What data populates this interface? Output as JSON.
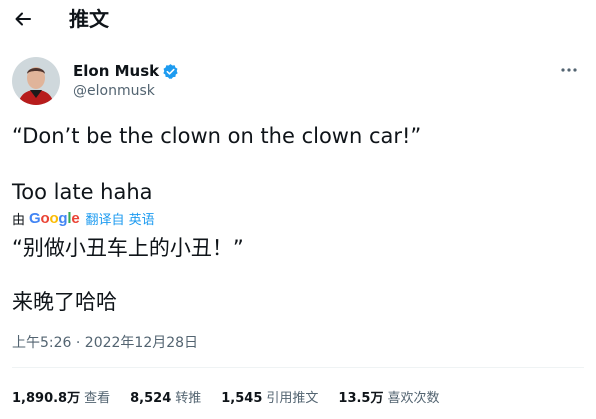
{
  "header": {
    "back_icon": "arrow-left-icon",
    "title": "推文"
  },
  "author": {
    "name": "Elon Musk",
    "handle": "@elonmusk",
    "verified": true,
    "verified_color": "#1d9bf0",
    "avatar_icon": "user-avatar-photo",
    "more_icon": "more-horizontal-icon"
  },
  "tweet": {
    "line1": "“Don’t be the clown on the clown car!”",
    "line2": "Too late haha"
  },
  "translation": {
    "by_label": "由",
    "provider": "Google",
    "link_text": "翻译自 英语",
    "line1": "“别做小丑车上的小丑！”",
    "line2": "来晚了哈哈"
  },
  "timestamp": "上午5:26 · 2022年12月28日",
  "stats": [
    {
      "value": "1,890.8万",
      "label": "查看"
    },
    {
      "value": "8,524",
      "label": "转推"
    },
    {
      "value": "1,545",
      "label": "引用推文"
    },
    {
      "value": "13.5万",
      "label": "喜欢次数"
    }
  ],
  "colors": {
    "text_primary": "#0f1419",
    "text_secondary": "#536471",
    "accent": "#1d9bf0",
    "divider": "#eff3f4"
  }
}
